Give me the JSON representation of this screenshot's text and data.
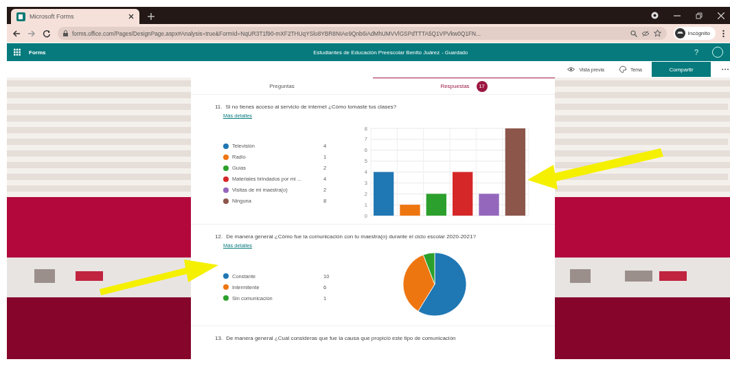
{
  "browser": {
    "tab_title": "Microsoft Forms",
    "url": "forms.office.com/Pages/DesignPage.aspx#Analysis=true&FormId=NqUR3T1f90-mXF2THUqYSlo8YBR8NIAe9Qnb6iAdMhUMVVlGSPdTTTA5Q1VPVkw0Q1FN...",
    "profile": "Incógnito"
  },
  "app_bar": {
    "app_name": "Forms",
    "form_title": "Estudiantes de Educación Preescolar Benito Juárez",
    "status": "- Guardado",
    "help": "?"
  },
  "toolbar": [
    {
      "label": "Vista previa",
      "kind": "preview"
    },
    {
      "label": "Tema",
      "kind": "theme"
    },
    {
      "label": "Compartir",
      "kind": "primary"
    }
  ],
  "tabs": [
    {
      "label": "Preguntas",
      "selected": false
    },
    {
      "label": "Respuestas",
      "selected": true,
      "badge": "17"
    }
  ],
  "questions": [
    {
      "number": "11.",
      "text": "Si no tienes acceso al servicio de internet ¿Cómo tomaste tus clases?",
      "link": "Más detalles",
      "options": [
        {
          "label": "Televisión",
          "count": "4",
          "color": "#1f77b4"
        },
        {
          "label": "Radio",
          "count": "1",
          "color": "#ee7611"
        },
        {
          "label": "Guías",
          "count": "2",
          "color": "#2ca02c"
        },
        {
          "label": "Materiales brindados por mi ...",
          "count": "4",
          "color": "#d62728"
        },
        {
          "label": "Visitas de mi maestra(o)",
          "count": "2",
          "color": "#9467bd"
        },
        {
          "label": "Ninguna",
          "count": "8",
          "color": "#8c564b"
        }
      ],
      "chart_data": {
        "type": "bar",
        "values": [
          4,
          1,
          2,
          4,
          2,
          8
        ],
        "ylim": [
          0,
          8
        ],
        "grid": true,
        "yticks": [
          0,
          1,
          2,
          3,
          4,
          5,
          6,
          7,
          8
        ]
      }
    },
    {
      "number": "12.",
      "text": "De manera general ¿Cómo fue la comunicación con tu maestra(o) durante el ciclo escolar 2020-2021?",
      "link": "Más detalles",
      "options": [
        {
          "label": "Constante",
          "count": "10",
          "color": "#1f77b4"
        },
        {
          "label": "Intermitente",
          "count": "6",
          "color": "#ee7611"
        },
        {
          "label": "Sin comunicación",
          "count": "1",
          "color": "#2ca02c"
        }
      ],
      "chart_data": {
        "type": "pie",
        "values": [
          58.8,
          35.3,
          5.9
        ]
      }
    },
    {
      "number": "13.",
      "text": "De manera general ¿Cuál consideras que fue la causa que propició este tipo de comunicación"
    }
  ]
}
